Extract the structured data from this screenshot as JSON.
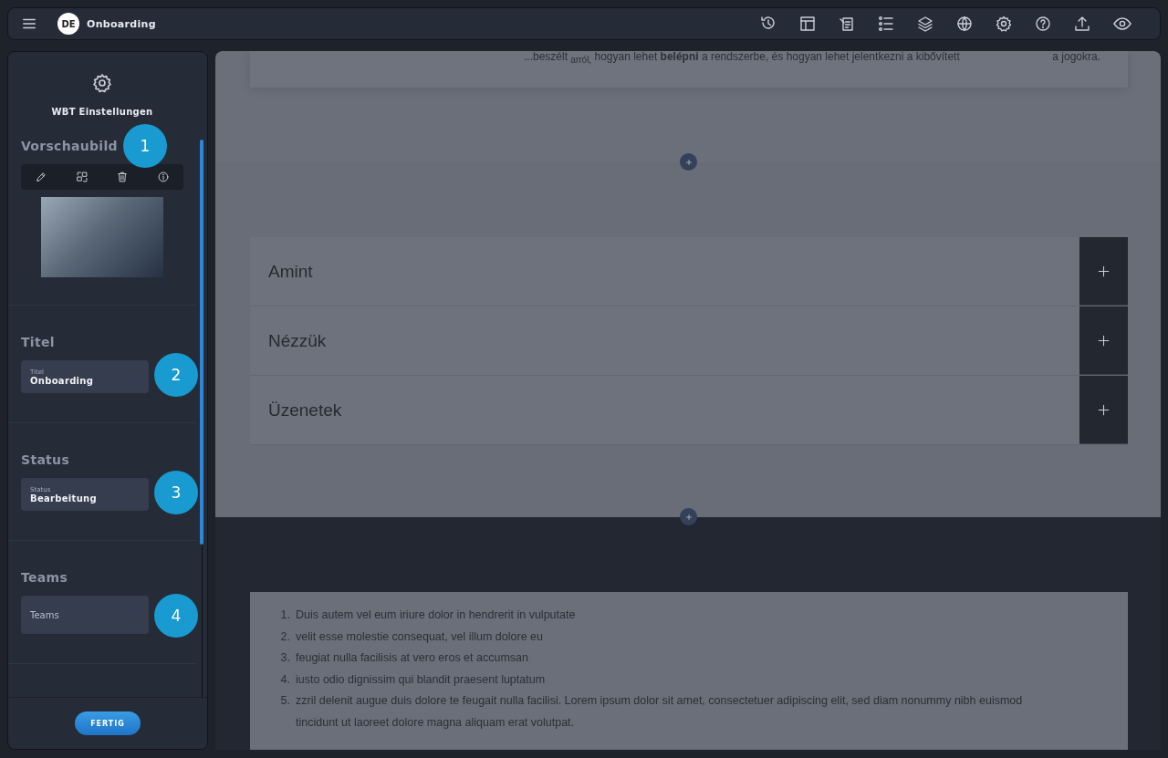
{
  "topbar": {
    "language": "DE",
    "title": "Onboarding"
  },
  "sidebar": {
    "heading": "WBT Einstellungen",
    "sections": [
      {
        "kind": "image",
        "title": "Vorschaubild",
        "marker": "1"
      },
      {
        "kind": "field",
        "title": "Titel",
        "label": "Titel",
        "value": "Onboarding",
        "marker": "2"
      },
      {
        "kind": "field",
        "title": "Status",
        "label": "Status",
        "value": "Bearbeitung",
        "marker": "3"
      },
      {
        "kind": "field",
        "title": "Teams",
        "placeholder": "Teams",
        "marker": "4"
      }
    ],
    "button": "FERTIG"
  },
  "content": {
    "intro_text": "...beszélt $_{arról,}$ hogyan lehet **belépni** a rendszerbe, és hogyan lehet jelentkezni a kibővített",
    "intro_link": "a jogokra.",
    "accordion": [
      {
        "title": "Amint"
      },
      {
        "title": "Nézzük"
      },
      {
        "title": "Üzenetek"
      }
    ],
    "list": [
      {
        "number": "1.",
        "text": "Duis autem vel eum iriure dolor in hendrerit in vulputate"
      },
      {
        "number": "2.",
        "text": "velit esse molestie consequat, vel illum dolore eu"
      },
      {
        "number": "3.",
        "text": "feugiat nulla facilisis at vero eros et accumsan"
      },
      {
        "number": "4.",
        "text": "iusto odio dignissim qui blandit praesent luptatum"
      },
      {
        "number": "5.",
        "text": "zzril delenit augue duis dolore te feugait nulla facilisi. Lorem ipsum dolor sit amet, consectetuer adipiscing elit, sed diam nonummy nibh euismod tincidunt ut laoreet dolore magna aliquam erat volutpat."
      }
    ]
  }
}
